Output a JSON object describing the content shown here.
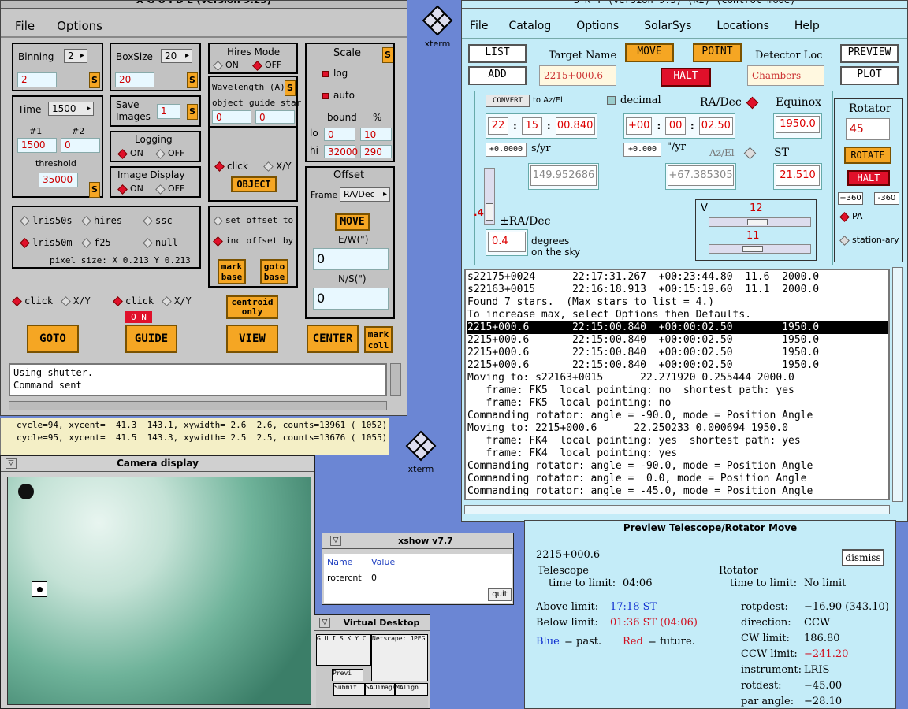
{
  "xguide": {
    "title": "X G U I D E (version 9.23)",
    "menu": [
      "File",
      "Options"
    ],
    "binning": {
      "label": "Binning",
      "select": "2",
      "value": "2",
      "set": "S"
    },
    "boxsize": {
      "label": "BoxSize",
      "select": "20",
      "value": "20",
      "set": "S"
    },
    "time": {
      "label": "Time",
      "select": "1500",
      "n1_label": "#1",
      "n2_label": "#2",
      "n1": "1500",
      "n2": "0",
      "threshold_label": "threshold",
      "threshold": "35000",
      "set": "S"
    },
    "save_images": {
      "label1": "Save",
      "label2": "Images",
      "value": "1",
      "set": "S"
    },
    "logging": {
      "label": "Logging",
      "on": "ON",
      "off": "OFF"
    },
    "image_display": {
      "label": "Image Display",
      "on": "ON",
      "off": "OFF"
    },
    "hires": {
      "label": "Hires Mode",
      "on": "ON",
      "off": "OFF"
    },
    "wavelength": {
      "label": "Wavelength (A)",
      "set": "S",
      "object": "object",
      "guide": "guide star",
      "obj_value": "0",
      "guide_value": "0"
    },
    "click": "click",
    "xy": "X/Y",
    "object_btn": "OBJECT",
    "scale": {
      "label": "Scale",
      "set": "S",
      "log": "log",
      "auto": "auto",
      "bound": "bound",
      "pct": "%",
      "lo": "lo",
      "hi": "hi",
      "lo_bound": "0",
      "lo_pct": "10",
      "hi_bound": "32000",
      "hi_pct": "290"
    },
    "offset": {
      "label": "Offset",
      "frame_label": "Frame",
      "frame": "RA/Dec",
      "move": "MOVE",
      "ew_label": "E/W(\")",
      "ew": "0",
      "ns_label": "N/S(\")",
      "ns": "0"
    },
    "instruments": [
      "lris50s",
      "hires",
      "ssc",
      "lris50m",
      "f25",
      "null"
    ],
    "pixel_size": "pixel size: X 0.213   Y 0.213",
    "set_offset": "set offset to",
    "inc_offset": "inc offset by",
    "mark_base": "mark base",
    "goto_base": "goto base",
    "guide_on": "O N",
    "centroid_only": "centroid only",
    "buttons": [
      "GOTO",
      "GUIDE",
      "VIEW",
      "CENTER"
    ],
    "mark_coll": "mark coll",
    "log": [
      "Using shutter.",
      "Command sent"
    ]
  },
  "cycles": [
    "cycle=94, xycent=  41.3  143.1, xywidth= 2.6  2.6, counts=13961 ( 1052)",
    "cycle=95, xycent=  41.5  143.3, xywidth= 2.5  2.5, counts=13676 ( 1055)"
  ],
  "camera": {
    "title": "Camera display"
  },
  "xterm_label": "xterm",
  "xshow": {
    "title": "xshow v7.7",
    "col_name": "Name",
    "col_value": "Value",
    "row_name": "rotercnt",
    "row_value": "0",
    "quit": "quit"
  },
  "vdesk": {
    "title": "Virtual Desktop",
    "items": [
      "G U I S K Y C",
      "Netscape: JPEG",
      "Previ",
      "Submit",
      "SAOimage",
      "MAlign"
    ]
  },
  "sky": {
    "title": "S K Y (version 9.3) (K2) (control mode)",
    "menu": [
      "File",
      "Catalog",
      "Options",
      "SolarSys",
      "Locations",
      "Help"
    ],
    "list": "LIST",
    "add": "ADD",
    "target_label": "Target Name",
    "target": "2215+000.6",
    "move": "MOVE",
    "halt": "HALT",
    "point": "POINT",
    "detector_label": "Detector Loc",
    "detector": "Chambers",
    "preview": "PREVIEW",
    "plot": "PLOT",
    "convert": "CONVERT",
    "to_azel": "to Az/El",
    "decimal": "decimal",
    "radec": "RA/Dec",
    "equinox_label": "Equinox",
    "equinox": "1950.0",
    "ra": [
      "22",
      "15",
      "00.840"
    ],
    "dec": [
      "+00",
      "00",
      "02.50"
    ],
    "ra_rate": "+0.0000",
    "ra_rate_unit": "s/yr",
    "dec_rate": "+0.000",
    "dec_rate_unit": "\"/yr",
    "azel": "Az/El",
    "az": "149.952686",
    "el": "+67.385305",
    "st_label": "ST",
    "st": "21.510",
    "rotator": {
      "label": "Rotator",
      "value": "45",
      "rotate": "ROTATE",
      "halt": "HALT",
      "p360": "+360",
      "m360": "-360",
      "pa": "PA",
      "stationary": "station-ary"
    },
    "offset_small": ".4",
    "pm_radec": "±RA/Dec",
    "deg_value": "0.4",
    "deg_label1": "degrees",
    "deg_label2": "on the sky",
    "v_label": "V",
    "v1": "12",
    "v2": "11",
    "list_lines": [
      {
        "t": "s22175+0024      22:17:31.267  +00:23:44.80  11.6  2000.0",
        "s": false
      },
      {
        "t": "s22163+0015      22:16:18.913  +00:15:19.60  11.1  2000.0",
        "s": false
      },
      {
        "t": "Found 7 stars.  (Max stars to list = 4.)",
        "s": false
      },
      {
        "t": "To increase max, select Options then Defaults.",
        "s": false
      },
      {
        "t": "2215+000.6       22:15:00.840  +00:00:02.50        1950.0",
        "s": true
      },
      {
        "t": "2215+000.6       22:15:00.840  +00:00:02.50        1950.0",
        "s": false
      },
      {
        "t": "2215+000.6       22:15:00.840  +00:00:02.50        1950.0",
        "s": false
      },
      {
        "t": "2215+000.6       22:15:00.840  +00:00:02.50        1950.0",
        "s": false
      },
      {
        "t": "Moving to: s22163+0015      22.271920 0.255444 2000.0",
        "s": false
      },
      {
        "t": "   frame: FK5  local pointing: no  shortest path: yes",
        "s": false
      },
      {
        "t": "   frame: FK5  local pointing: no",
        "s": false
      },
      {
        "t": "Commanding rotator: angle = -90.0, mode = Position Angle",
        "s": false
      },
      {
        "t": "Moving to: 2215+000.6      22.250233 0.000694 1950.0",
        "s": false
      },
      {
        "t": "   frame: FK4  local pointing: yes  shortest path: yes",
        "s": false
      },
      {
        "t": "   frame: FK4  local pointing: yes",
        "s": false
      },
      {
        "t": "Commanding rotator: angle = -90.0, mode = Position Angle",
        "s": false
      },
      {
        "t": "Commanding rotator: angle =  0.0, mode = Position Angle",
        "s": false
      },
      {
        "t": "Commanding rotator: angle = -45.0, mode = Position Angle",
        "s": false
      }
    ]
  },
  "preview": {
    "title": "Preview Telescope/Rotator Move",
    "target": "2215+000.6",
    "dismiss": "dismiss",
    "telescope": "Telescope",
    "rotator": "Rotator",
    "ttl_label": "time to limit:",
    "ttl": "04:06",
    "rttl_label": "time to limit:",
    "rttl": "No limit",
    "above_label": "Above limit:",
    "above": "17:18 ST",
    "below_label": "Below limit:",
    "below": "01:36 ST  (04:06)",
    "blue": "Blue",
    "blue_txt": "= past.",
    "red": "Red",
    "red_txt": "= future.",
    "rot": [
      [
        "rotpdest:",
        "−16.90 (343.10)"
      ],
      [
        "direction:",
        "CCW"
      ],
      [
        "CW  limit:",
        "186.80"
      ],
      [
        "CCW limit:",
        "−241.20"
      ],
      [
        "instrument:",
        "LRIS"
      ],
      [
        "rotdest:",
        "−45.00"
      ],
      [
        "par angle:",
        "−28.10"
      ]
    ]
  },
  "colors": {
    "orange": "#f5a623",
    "red": "#e0102a",
    "desktop": "#6b86d4",
    "sky_bg": "#c4ecf8",
    "panel": "#c2c2c2"
  }
}
